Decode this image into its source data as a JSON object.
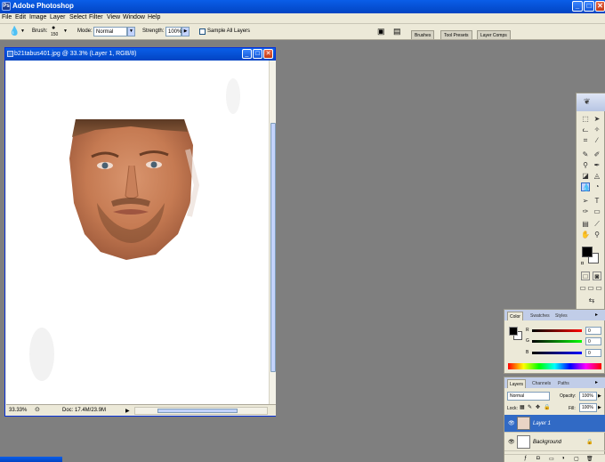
{
  "app": {
    "title": "Adobe Photoshop"
  },
  "menu": [
    "File",
    "Edit",
    "Image",
    "Layer",
    "Select",
    "Filter",
    "View",
    "Window",
    "Help"
  ],
  "options": {
    "brush_label": "Brush:",
    "brush_size": "150",
    "mode_label": "Mode:",
    "mode_value": "Normal",
    "strength_label": "Strength:",
    "strength_value": "100%",
    "sample_all_layers": "Sample All Layers",
    "palette_well_tabs": [
      "Brushes",
      "Tool Presets",
      "Layer Comps"
    ]
  },
  "document": {
    "title": "b21tabus401.jpg @ 33.3% (Layer 1, RGB/8)",
    "zoom": "33.33%",
    "doc_size": "Doc: 17.4M/23.9M"
  },
  "color_panel": {
    "tabs": [
      "Color",
      "Swatches",
      "Styles"
    ],
    "channels": [
      {
        "label": "R",
        "value": "0"
      },
      {
        "label": "G",
        "value": "0"
      },
      {
        "label": "B",
        "value": "0"
      }
    ],
    "colors": {
      "foreground": "#000000",
      "background": "#ffffff"
    }
  },
  "layers_panel": {
    "tabs": [
      "Layers",
      "Channels",
      "Paths"
    ],
    "blend_mode": "Normal",
    "opacity_label": "Opacity:",
    "opacity_value": "100%",
    "lock_label": "Lock:",
    "fill_label": "Fill:",
    "fill_value": "100%",
    "layers": [
      {
        "name": "Layer 1",
        "selected": true
      },
      {
        "name": "Background",
        "selected": false,
        "locked": true
      }
    ]
  },
  "colors": {
    "titlebar": "#0a5ee8",
    "workspace": "#7f7f7f",
    "panel": "#ece9d8",
    "selection": "#316ac5"
  }
}
